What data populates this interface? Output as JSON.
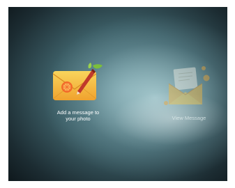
{
  "tiles": [
    {
      "label": "Add a message to\nyour photo",
      "icon": "envelope-pen-icon"
    },
    {
      "label": "View Message",
      "icon": "open-envelope-icon"
    }
  ],
  "colors": {
    "envelope_orange": "#f2a531",
    "envelope_yellow": "#f7c94a",
    "pen_red": "#c0392b",
    "leaf_green": "#7cbf3a",
    "background_dark": "#0c1418",
    "background_light": "#aacdd2"
  }
}
